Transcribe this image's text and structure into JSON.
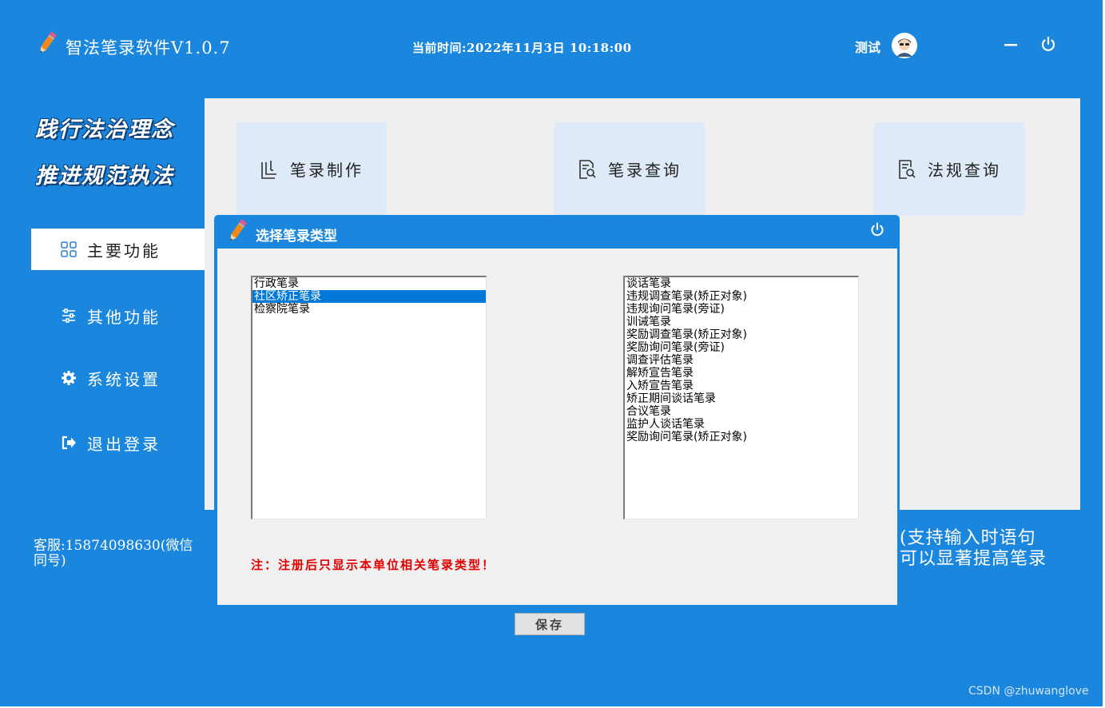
{
  "app": {
    "title": "智法笔录软件V1.0.7",
    "clock": "当前时间:2022年11月3日  10:18:00",
    "user": "测试",
    "accent": "#1a86dd"
  },
  "sidebar": {
    "slogans": [
      "践行法治理念",
      "推进规范执法"
    ],
    "nav": [
      {
        "label": "主要功能",
        "icon": "grid-icon",
        "active": true
      },
      {
        "label": "其他功能",
        "icon": "sliders-icon",
        "active": false
      },
      {
        "label": "系统设置",
        "icon": "gear-icon",
        "active": false
      },
      {
        "label": "退出登录",
        "icon": "logout-icon",
        "active": false
      }
    ],
    "service": "客服:15874098630(微信同号)"
  },
  "cards": [
    {
      "label": "笔录制作",
      "icon": "document-edit-icon"
    },
    {
      "label": "笔录查询",
      "icon": "document-search-icon"
    },
    {
      "label": "法规查询",
      "icon": "law-search-icon"
    }
  ],
  "tip": {
    "line1": "(支持输入时语句",
    "line2": "可以显著提高笔录"
  },
  "modal": {
    "title": "选择笔录类型",
    "categories": [
      "行政笔录",
      "社区矫正笔录",
      "检察院笔录"
    ],
    "selected_category": 1,
    "types": [
      "谈话笔录",
      "违规调查笔录(矫正对象)",
      "违规询问笔录(旁证)",
      "训诫笔录",
      "奖励调查笔录(矫正对象)",
      "奖励询问笔录(旁证)",
      "调查评估笔录",
      "解矫宣告笔录",
      "入矫宣告笔录",
      "矫正期间谈话笔录",
      "合议笔录",
      "监护人谈话笔录",
      "奖励询问笔录(矫正对象)"
    ],
    "note": "注：注册后只显示本单位相关笔录类型！",
    "save_label": "保存",
    "note_color": "#e00000"
  },
  "watermark": "CSDN @zhuwanglove"
}
